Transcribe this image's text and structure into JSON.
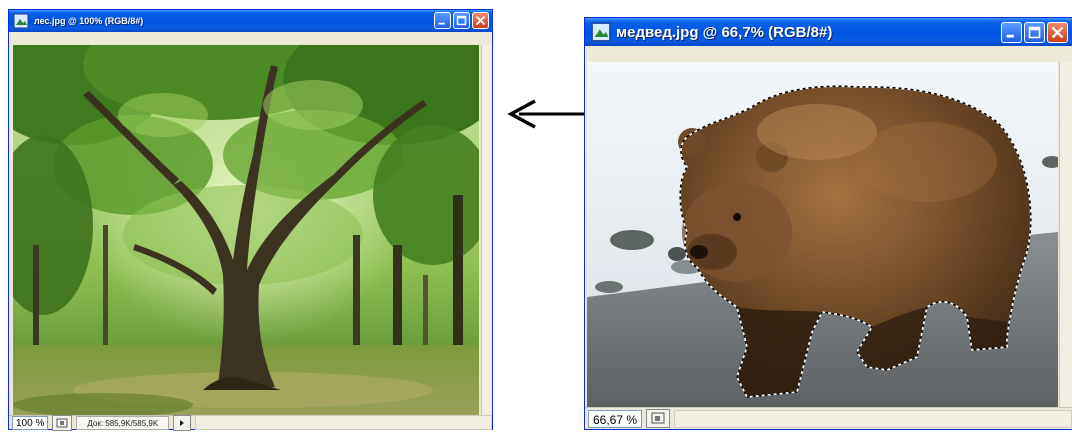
{
  "windows": [
    {
      "title": "лес.jpg @ 100% (RGB/8#)",
      "zoom": "100 %",
      "doc_info": "Док: 585,9K/585,9K",
      "image": "forest-photo"
    },
    {
      "title": "медвед.jpg @ 66,7% (RGB/8#)",
      "zoom": "66,67 %",
      "image": "bear-photo-with-selection"
    }
  ],
  "annotation": {
    "arrow": "left-arrow"
  },
  "icons": [
    "photoshop-doc-icon",
    "minimize-icon",
    "maximize-icon",
    "close-icon",
    "navigator-icon",
    "arrow-right-icon"
  ],
  "colors": {
    "title_bar": "#0054e3",
    "close_button": "#c8401c",
    "window_bg": "#ece9d8"
  }
}
